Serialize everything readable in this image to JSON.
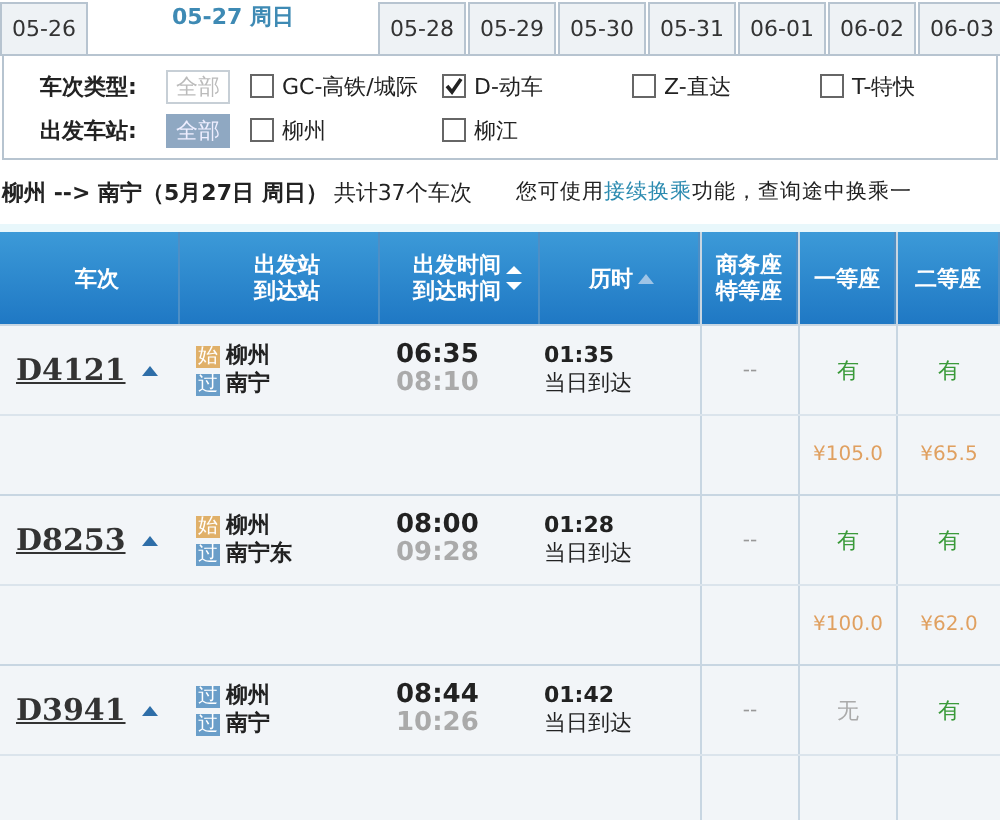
{
  "date_tabs": [
    {
      "label": "05-26",
      "selected": false
    },
    {
      "label": "05-27 周日",
      "selected": true
    },
    {
      "label": "05-28",
      "selected": false
    },
    {
      "label": "05-29",
      "selected": false
    },
    {
      "label": "05-30",
      "selected": false
    },
    {
      "label": "05-31",
      "selected": false
    },
    {
      "label": "06-01",
      "selected": false
    },
    {
      "label": "06-02",
      "selected": false
    },
    {
      "label": "06-03",
      "selected": false
    }
  ],
  "filters": [
    {
      "label": "车次类型:",
      "all": {
        "label": "全部",
        "selected": false
      },
      "options": [
        {
          "label": "GC-高铁/城际",
          "checked": false
        },
        {
          "label": "D-动车",
          "checked": true
        },
        {
          "label": "Z-直达",
          "checked": false
        },
        {
          "label": "T-特快",
          "checked": false
        }
      ]
    },
    {
      "label": "出发车站:",
      "all": {
        "label": "全部",
        "selected": true
      },
      "options": [
        {
          "label": "柳州",
          "checked": false
        },
        {
          "label": "柳江",
          "checked": false
        }
      ]
    }
  ],
  "summary": {
    "route": "柳州 --> 南宁（5月27日  周日）",
    "count": "共计37个车次",
    "hint_before": "您可使用",
    "hint_link": "接续换乘",
    "hint_after": "功能，查询途中换乘一"
  },
  "table": {
    "columns": [
      [
        "车次"
      ],
      [
        "出发站",
        "到达站"
      ],
      [
        "出发时间",
        "到达时间"
      ],
      [
        "历时"
      ],
      [
        "商务座",
        "特等座"
      ],
      [
        "一等座"
      ],
      [
        "二等座"
      ]
    ],
    "rows": [
      {
        "train": "D4121",
        "from": {
          "badge": "始",
          "kind": "origin",
          "name": "柳州"
        },
        "to": {
          "badge": "过",
          "kind": "pass",
          "name": "南宁"
        },
        "depart": "06:35",
        "arrive": "08:10",
        "duration": "01:35",
        "arrival_day": "当日到达",
        "business": "--",
        "seats": [
          {
            "text": "有",
            "available": true
          },
          {
            "text": "有",
            "available": true
          }
        ],
        "prices": [
          "¥105.0",
          "¥65.5"
        ]
      },
      {
        "train": "D8253",
        "from": {
          "badge": "始",
          "kind": "origin",
          "name": "柳州"
        },
        "to": {
          "badge": "过",
          "kind": "pass",
          "name": "南宁东"
        },
        "depart": "08:00",
        "arrive": "09:28",
        "duration": "01:28",
        "arrival_day": "当日到达",
        "business": "--",
        "seats": [
          {
            "text": "有",
            "available": true
          },
          {
            "text": "有",
            "available": true
          }
        ],
        "prices": [
          "¥100.0",
          "¥62.0"
        ]
      },
      {
        "train": "D3941",
        "from": {
          "badge": "过",
          "kind": "pass",
          "name": "柳州"
        },
        "to": {
          "badge": "过",
          "kind": "pass",
          "name": "南宁"
        },
        "depart": "08:44",
        "arrive": "10:26",
        "duration": "01:42",
        "arrival_day": "当日到达",
        "business": "--",
        "seats": [
          {
            "text": "无",
            "available": false
          },
          {
            "text": "有",
            "available": true
          }
        ],
        "prices": []
      }
    ]
  }
}
